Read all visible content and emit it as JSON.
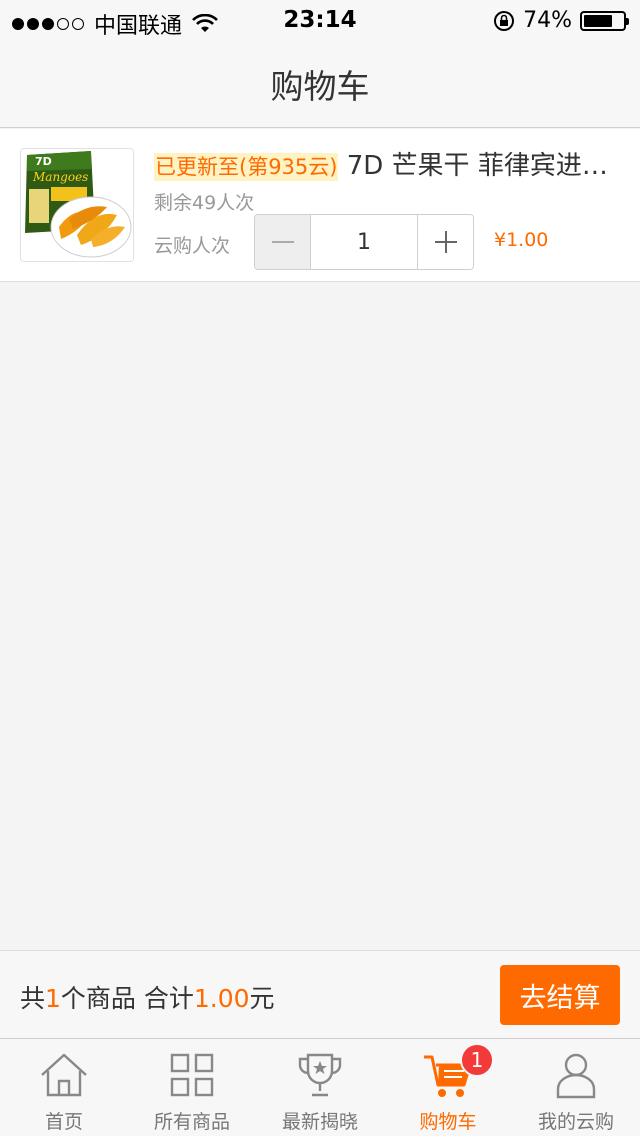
{
  "status_bar": {
    "carrier": "中国联通",
    "time": "23:14",
    "battery": "74%",
    "battery_level": 0.74
  },
  "nav": {
    "title": "购物车"
  },
  "cart": {
    "items": [
      {
        "image_icon": "dried-mango-package",
        "image_text": "Mangoes",
        "update_tag": "已更新至(第935云)",
        "name": " 7D 芒果干 菲律宾进…",
        "remaining": "剩余49人次",
        "qty_label": "云购人次",
        "quantity": "1",
        "price": "¥1.00"
      }
    ]
  },
  "summary": {
    "prefix": "共",
    "count": "1",
    "mid": "个商品 合计",
    "total": "1.00",
    "suffix": "元",
    "checkout_label": "去结算"
  },
  "tabs": [
    {
      "label": "首页",
      "icon": "home-icon"
    },
    {
      "label": "所有商品",
      "icon": "grid-icon"
    },
    {
      "label": "最新揭晓",
      "icon": "trophy-icon"
    },
    {
      "label": "购物车",
      "icon": "cart-icon",
      "active": true,
      "badge": "1"
    },
    {
      "label": "我的云购",
      "icon": "user-icon"
    }
  ],
  "colors": {
    "accent": "#ff6a00",
    "badge": "#f23a3a"
  }
}
